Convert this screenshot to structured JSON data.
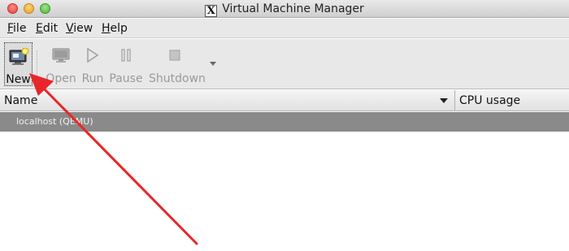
{
  "window": {
    "title": "Virtual Machine Manager"
  },
  "menubar": {
    "items": [
      {
        "mnemonic": "F",
        "rest": "ile"
      },
      {
        "mnemonic": "E",
        "rest": "dit"
      },
      {
        "mnemonic": "V",
        "rest": "iew"
      },
      {
        "mnemonic": "H",
        "rest": "elp"
      }
    ]
  },
  "toolbar": {
    "new_label": "New",
    "open_label": "Open",
    "run_label": "Run",
    "pause_label": "Pause",
    "shutdown_label": "Shutdown"
  },
  "columns": {
    "name": "Name",
    "cpu": "CPU usage"
  },
  "connections": [
    {
      "label": "localhost (QEMU)"
    }
  ],
  "colors": {
    "annotation_arrow": "#e8262a",
    "connection_row": "#8a8a8a"
  }
}
